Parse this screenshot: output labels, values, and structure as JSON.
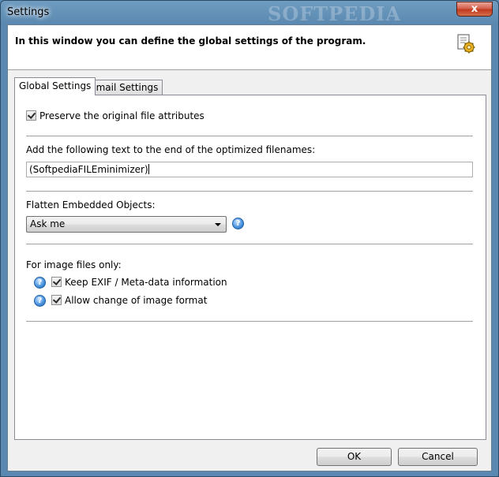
{
  "window": {
    "title": "Settings",
    "watermark": "SOFTPEDIA",
    "close_glyph": "x"
  },
  "header": {
    "text": "In this window you can define the global settings of the program.",
    "icon": "settings-gear-icon"
  },
  "tabs": [
    {
      "label": "Global Settings",
      "active": true
    },
    {
      "label": "Email Settings",
      "active": false
    }
  ],
  "settings": {
    "preserve_attributes": {
      "label": "Preserve the original file attributes",
      "checked": true
    },
    "append_text": {
      "label": "Add the following text to the end of the optimized filenames:",
      "value": "(SoftpediaFILEminimizer)"
    },
    "flatten": {
      "label": "Flatten Embedded Objects:",
      "selected": "Ask me"
    },
    "image_section": {
      "label": "For image files only:",
      "keep_exif": {
        "label": "Keep EXIF / Meta-data information",
        "checked": true
      },
      "allow_format_change": {
        "label": "Allow change of image format",
        "checked": true
      }
    }
  },
  "help_glyph": "?",
  "buttons": {
    "ok": "OK",
    "cancel": "Cancel"
  },
  "colors": {
    "titlebar": "#5a88b0",
    "close_button": "#c2391f",
    "help_icon": "#4f97e0"
  }
}
